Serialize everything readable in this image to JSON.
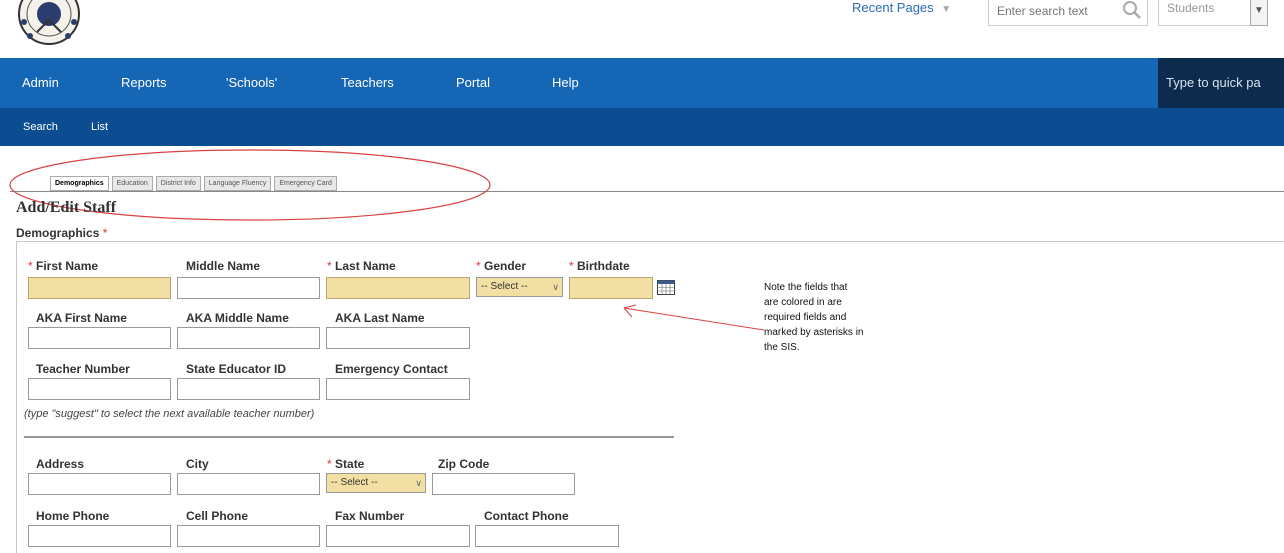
{
  "header": {
    "recent_pages": "Recent Pages",
    "search_placeholder": "Enter search text",
    "role_value": "Students"
  },
  "main_nav": {
    "items": [
      {
        "label": "Admin"
      },
      {
        "label": "Reports"
      },
      {
        "label": "'Schools'"
      },
      {
        "label": "Teachers"
      },
      {
        "label": "Portal"
      },
      {
        "label": "Help"
      }
    ],
    "quick_placeholder": "Type to quick pa"
  },
  "sub_nav": {
    "items": [
      {
        "label": "Search"
      },
      {
        "label": "List"
      }
    ]
  },
  "tabs": [
    {
      "label": "Demographics",
      "active": true
    },
    {
      "label": "Education",
      "active": false
    },
    {
      "label": "District Info",
      "active": false
    },
    {
      "label": "Language Fluency",
      "active": false
    },
    {
      "label": "Emergency Card",
      "active": false
    }
  ],
  "page": {
    "title": "Add/Edit Staff",
    "section": "Demographics",
    "required_marker": "*"
  },
  "form": {
    "first_name": {
      "label": "First Name",
      "value": ""
    },
    "middle_name": {
      "label": "Middle Name",
      "value": ""
    },
    "last_name": {
      "label": "Last Name",
      "value": ""
    },
    "gender": {
      "label": "Gender",
      "value": "-- Select --"
    },
    "birthdate": {
      "label": "Birthdate",
      "value": ""
    },
    "aka_first": {
      "label": "AKA First Name",
      "value": ""
    },
    "aka_middle": {
      "label": "AKA Middle Name",
      "value": ""
    },
    "aka_last": {
      "label": "AKA Last Name",
      "value": ""
    },
    "teacher_number": {
      "label": "Teacher Number",
      "value": ""
    },
    "state_educator_id": {
      "label": "State Educator ID",
      "value": ""
    },
    "emergency_contact": {
      "label": "Emergency Contact",
      "value": ""
    },
    "hint": "(type \"suggest\" to select the next available teacher number)",
    "address": {
      "label": "Address",
      "value": ""
    },
    "city": {
      "label": "City",
      "value": ""
    },
    "state": {
      "label": "State",
      "value": "-- Select --"
    },
    "zip": {
      "label": "Zip Code",
      "value": ""
    },
    "home_phone": {
      "label": "Home Phone",
      "value": ""
    },
    "cell_phone": {
      "label": "Cell Phone",
      "value": ""
    },
    "fax_number": {
      "label": "Fax Number",
      "value": ""
    },
    "contact_phone": {
      "label": "Contact Phone",
      "value": ""
    }
  },
  "annotation": {
    "note_lines": [
      "Note the fields that",
      "are colored in are",
      "required fields and",
      "marked by asterisks in",
      "the SIS."
    ]
  },
  "colors": {
    "nav_primary": "#1566b4",
    "nav_secondary": "#0c4d91",
    "quick_panel": "#0d2c4d",
    "required_field": "#f2dfa4",
    "required_marker": "#dd3333",
    "annotation_red": "#d94040"
  },
  "icons": [
    "school-seal-logo",
    "search-icon",
    "chevron-down-icon",
    "calendar-icon",
    "annotation-arrow"
  ]
}
